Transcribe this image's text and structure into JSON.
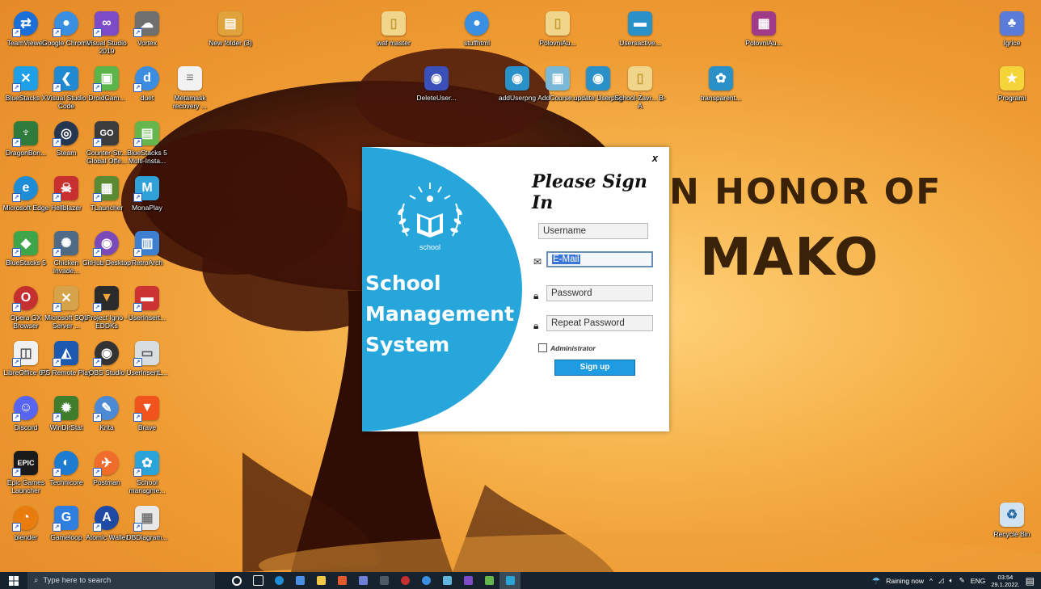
{
  "wallpaper": {
    "line1": "N HONOR OF",
    "line2": "MAKO"
  },
  "desktop_icons": [
    {
      "label": "TeamViewer",
      "color": "#1a6fd8",
      "glyph": "⇄"
    },
    {
      "label": "Google Chrome",
      "color": "#3a8fe0",
      "glyph": "●"
    },
    {
      "label": "Visual Studio 2019",
      "color": "#7d4bc8",
      "glyph": "∞"
    },
    {
      "label": "Vortex",
      "color": "#6f6f6f",
      "glyph": "☁"
    },
    {
      "label": "BlueStacks X",
      "color": "#1ea0e8",
      "glyph": "✕"
    },
    {
      "label": "Visual Studio Code",
      "color": "#1f8ad2",
      "glyph": "❮"
    },
    {
      "label": "DroidCam...",
      "color": "#5bb54a",
      "glyph": "▣"
    },
    {
      "label": "duet",
      "color": "#3c8de0",
      "glyph": "d"
    },
    {
      "label": "DragonBon...",
      "color": "#2f7b3b",
      "glyph": "♆"
    },
    {
      "label": "Steam",
      "color": "#253650",
      "glyph": "◎"
    },
    {
      "label": "Counter-Str... Global Offe...",
      "color": "#3c3c3c",
      "glyph": "GO"
    },
    {
      "label": "BlueStacks 5 Multi-Insta...",
      "color": "#64b64d",
      "glyph": "▤"
    },
    {
      "label": "Microsoft Edge",
      "color": "#1f8cd6",
      "glyph": "e"
    },
    {
      "label": "Hellblazer",
      "color": "#c83030",
      "glyph": "☠"
    },
    {
      "label": "TLauncher",
      "color": "#5a8a34",
      "glyph": "▦"
    },
    {
      "label": "MonaPlay",
      "color": "#2fa0d8",
      "glyph": "M"
    },
    {
      "label": "BlueStacks 5",
      "color": "#3fa54b",
      "glyph": "◆"
    },
    {
      "label": "Chicken Invade...",
      "color": "#4e6a84",
      "glyph": "✺"
    },
    {
      "label": "GitHub Desktop",
      "color": "#7a4bb8",
      "glyph": "◉"
    },
    {
      "label": "RetroArch",
      "color": "#3d7fd0",
      "glyph": "▥"
    },
    {
      "label": "Opera GX Browser",
      "color": "#c43030",
      "glyph": "O"
    },
    {
      "label": "Microsoft SQL Server ...",
      "color": "#d6a24a",
      "glyph": "✕"
    },
    {
      "label": "Project Igno - EDDKs",
      "color": "#2b2b2b",
      "glyph": "▼"
    },
    {
      "label": "UserInsert...",
      "color": "#cc3333",
      "glyph": "▬"
    },
    {
      "label": "LibreOffice 6.7",
      "color": "#f0f0f0",
      "glyph": "◫"
    },
    {
      "label": "PS Remote Play",
      "color": "#1c5ab2",
      "glyph": "◭"
    },
    {
      "label": "OBS Studio",
      "color": "#333333",
      "glyph": "◉"
    },
    {
      "label": "UserInsertL...",
      "color": "#d8dde2",
      "glyph": "▭"
    },
    {
      "label": "Discord",
      "color": "#5865f2",
      "glyph": "☺"
    },
    {
      "label": "WinDirStat",
      "color": "#3f7d2c",
      "glyph": "✹"
    },
    {
      "label": "Krita",
      "color": "#4c8ad6",
      "glyph": "✎"
    },
    {
      "label": "Brave",
      "color": "#f0531c",
      "glyph": "▼"
    },
    {
      "label": "Epic Games Launcher",
      "color": "#1a1a1a",
      "glyph": "EPIC"
    },
    {
      "label": "Technicore",
      "color": "#1d7cd0",
      "glyph": "◐"
    },
    {
      "label": "Postman",
      "color": "#ef6c2b",
      "glyph": "✈"
    },
    {
      "label": "School managme...",
      "color": "#2aa4d8",
      "glyph": "✿"
    },
    {
      "label": "blender",
      "color": "#e87d0d",
      "glyph": "◔"
    },
    {
      "label": "Gameloop",
      "color": "#2f7fe0",
      "glyph": "G"
    },
    {
      "label": "Atomic Wallet",
      "color": "#1f4aa4",
      "glyph": "A"
    },
    {
      "label": "DBDiagram...",
      "color": "#e8e8e8",
      "glyph": "▦"
    },
    {
      "label": "New folder (3)",
      "color": "#e0a23a",
      "glyph": "▤"
    },
    {
      "label": "Metamask recovery ...",
      "color": "#f2f2f2",
      "glyph": "≡"
    },
    {
      "label": "waf master",
      "color": "#f1d58a",
      "glyph": "▯"
    },
    {
      "label": "DeleteUser...",
      "color": "#3a4fb8",
      "glyph": "◉"
    },
    {
      "label": "stuffhtml",
      "color": "#3a8fe0",
      "glyph": "●"
    },
    {
      "label": "addUserpng",
      "color": "#2a90c8",
      "glyph": "◉"
    },
    {
      "label": "AddCourse...",
      "color": "#7ab8d8",
      "glyph": "▣"
    },
    {
      "label": "PolovniAu...",
      "color": "#f1d58a",
      "glyph": "▯"
    },
    {
      "label": "update Userpng",
      "color": "#2a90c8",
      "glyph": "◉"
    },
    {
      "label": "Usersactive...",
      "color": "#2a90c8",
      "glyph": "▬"
    },
    {
      "label": "School-Zavr... B-A",
      "color": "#f1d58a",
      "glyph": "▯"
    },
    {
      "label": "PolovniAu...",
      "color": "#a03b8a",
      "glyph": "▦"
    },
    {
      "label": "transparent...",
      "color": "#2a90c8",
      "glyph": "✿"
    },
    {
      "label": "Igrice",
      "color": "#5b7bd8",
      "glyph": "♣"
    },
    {
      "label": "Programi",
      "color": "#f5d43a",
      "glyph": "★"
    },
    {
      "label": "Recycle Bin",
      "color": "#cfe3f0",
      "glyph": "♻"
    }
  ],
  "signin": {
    "app_title_line1": "School",
    "app_title_line2": "Management",
    "app_title_line3": "System",
    "logo_text": "school",
    "close_label": "x",
    "form_title": "Please Sign In",
    "username_placeholder": "Username",
    "email_value": "E-Mail",
    "password_placeholder": "Password",
    "repeat_password_placeholder": "Repeat Password",
    "admin_label": "Administrator",
    "signup_label": "Sign up"
  },
  "taskbar": {
    "search_placeholder": "Type here to search",
    "weather": "Raining now",
    "language": "ENG",
    "time": "03:54",
    "date": "29.1.2022."
  },
  "colors": {
    "accent": "#27a6dc",
    "taskbar": "#16232e",
    "button": "#1e9be1"
  }
}
